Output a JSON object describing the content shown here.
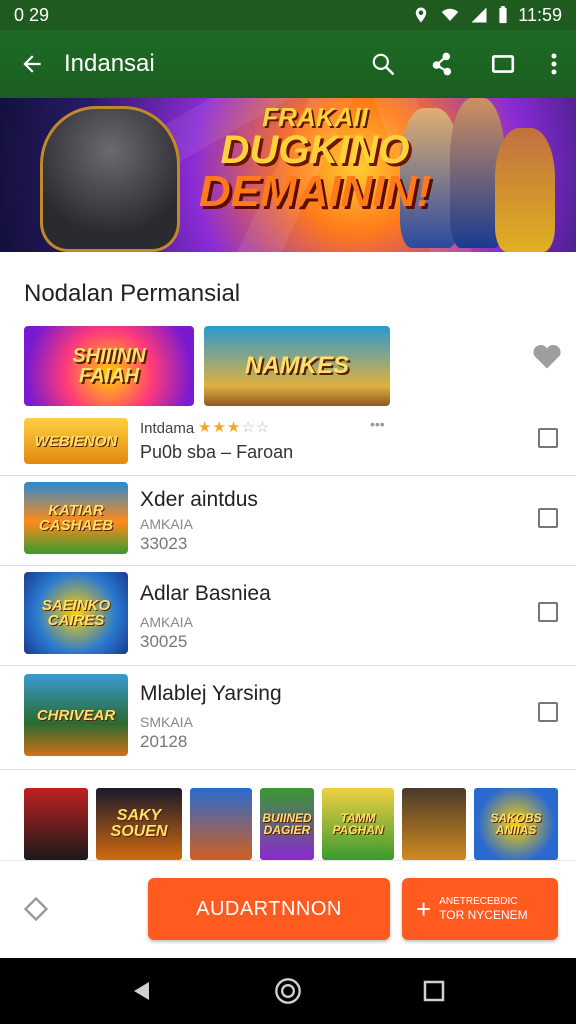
{
  "status": {
    "left": "0 29",
    "time": "11:59"
  },
  "appbar": {
    "title": "Indansai",
    "icons": [
      "back-arrow-icon",
      "search-icon",
      "share-icon",
      "window-icon",
      "more-vert-icon"
    ]
  },
  "banner": {
    "line1": "FRAKAII",
    "line2": "DUGKINO",
    "line3": "DEMAININ!"
  },
  "section": {
    "title": "Nodalan Permansial"
  },
  "featured": [
    {
      "art": "SHIIINN\nFAIAH"
    },
    {
      "art": "NAMKES"
    }
  ],
  "items": [
    {
      "name": "Intdama",
      "sub": "Pu0b sba – Faroan",
      "art": "WEBIENON",
      "rating": 3
    },
    {
      "name": "Xder aintdus",
      "sub": "AMKAIA",
      "num": "33023",
      "art": "KATIAR\nCASHAEB"
    },
    {
      "name": "Adlar Basniea",
      "sub": "AMKAIA",
      "num": "30025",
      "art": "SAEINKO\nCAIRES"
    },
    {
      "name": "Mlablej Yarsing",
      "sub": "SMKAIA",
      "num": "20128",
      "art": "CHRIVEAR"
    }
  ],
  "strip": [
    {
      "art": ""
    },
    {
      "art": "SAKY\nSOUEN"
    },
    {
      "art": ""
    },
    {
      "art": "BUIINED\nDAGIER"
    },
    {
      "art": "TAMM\nPAGHAN"
    },
    {
      "art": ""
    },
    {
      "art": "SAKOBS\nANIIAS"
    }
  ],
  "bottom": {
    "primary": "AUDARTNNON",
    "secondary_line1": "ANETRECEBDIC",
    "secondary_line2": "TOR NYCENEM"
  },
  "colors": {
    "appbar": "#1b5e20",
    "accent": "#ff5a1f"
  }
}
